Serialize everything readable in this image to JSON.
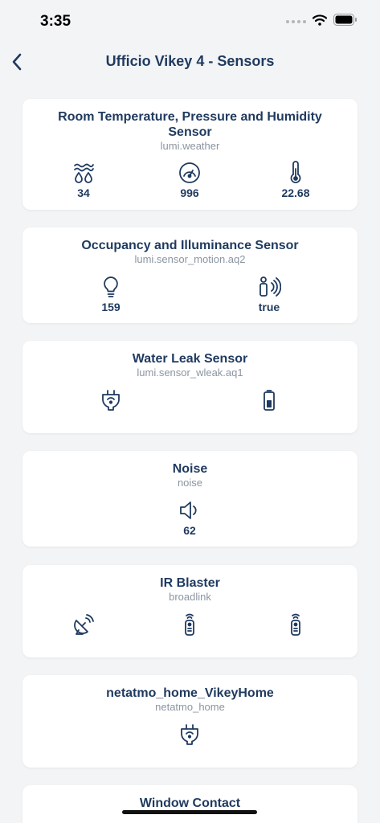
{
  "status": {
    "time": "3:35"
  },
  "nav": {
    "title": "Ufficio Vikey 4 - Sensors"
  },
  "cards": [
    {
      "title": "Room Temperature, Pressure and Humidity Sensor",
      "subtitle": "lumi.weather",
      "sensors": [
        {
          "icon": "humidity-icon",
          "value": "34"
        },
        {
          "icon": "pressure-gauge-icon",
          "value": "996"
        },
        {
          "icon": "thermometer-icon",
          "value": "22.68"
        }
      ]
    },
    {
      "title": "Occupancy and Illuminance Sensor",
      "subtitle": "lumi.sensor_motion.aq2",
      "sensors": [
        {
          "icon": "lightbulb-icon",
          "value": "159"
        },
        {
          "icon": "motion-sensor-icon",
          "value": "true"
        }
      ]
    },
    {
      "title": "Water Leak Sensor",
      "subtitle": "lumi.sensor_wleak.aq1",
      "sensors": [
        {
          "icon": "smart-plug-icon"
        },
        {
          "icon": "battery-icon"
        }
      ]
    },
    {
      "title": "Noise",
      "subtitle": "noise",
      "sensors": [
        {
          "icon": "speaker-icon",
          "value": "62"
        }
      ]
    },
    {
      "title": "IR Blaster",
      "subtitle": "broadlink",
      "sensors": [
        {
          "icon": "satellite-dish-icon"
        },
        {
          "icon": "remote-control-icon"
        },
        {
          "icon": "remote-control-icon"
        }
      ]
    },
    {
      "title": "netatmo_home_VikeyHome",
      "subtitle": "netatmo_home",
      "sensors": [
        {
          "icon": "smart-plug-icon"
        }
      ]
    },
    {
      "title": "Window Contact"
    }
  ],
  "colors": {
    "accent": "#1f3a5f",
    "subtitle": "#8b95a1",
    "background": "#f3f4f6"
  }
}
